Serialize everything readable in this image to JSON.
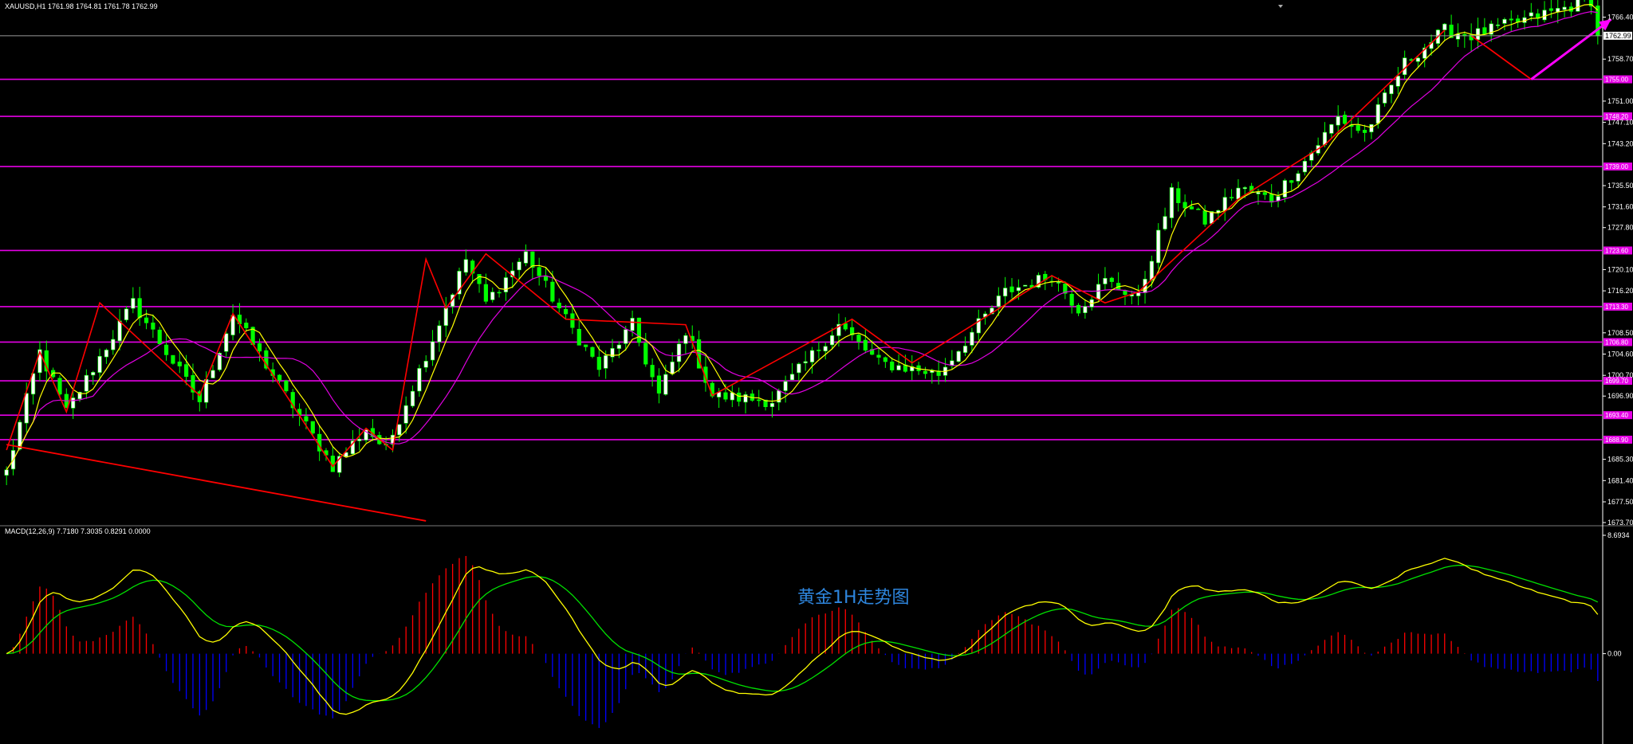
{
  "chart_data": [
    {
      "type": "candlestick",
      "symbol_info": "XAUUSD,H1  1761.98 1764.81 1761.78 1762.99",
      "ylim": [
        1673.7,
        1767.5
      ],
      "yticks": [
        {
          "label": "1766.40",
          "value": 1766.4
        },
        {
          "label": "1758.70",
          "value": 1758.7
        },
        {
          "label": "1751.00",
          "value": 1751.0
        },
        {
          "label": "1747.10",
          "value": 1747.1
        },
        {
          "label": "1743.20",
          "value": 1743.2
        },
        {
          "label": "1735.50",
          "value": 1735.5
        },
        {
          "label": "1731.60",
          "value": 1731.6
        },
        {
          "label": "1727.80",
          "value": 1727.8
        },
        {
          "label": "1720.10",
          "value": 1720.1
        },
        {
          "label": "1716.20",
          "value": 1716.2
        },
        {
          "label": "1708.50",
          "value": 1708.5
        },
        {
          "label": "1704.60",
          "value": 1704.6
        },
        {
          "label": "1700.70",
          "value": 1700.7
        },
        {
          "label": "1696.90",
          "value": 1696.9
        },
        {
          "label": "1685.30",
          "value": 1685.3
        },
        {
          "label": "1681.40",
          "value": 1681.4
        },
        {
          "label": "1677.50",
          "value": 1677.5
        },
        {
          "label": "1673.70",
          "value": 1673.7
        }
      ],
      "current_price": {
        "label": "1762.99",
        "value": 1762.99
      },
      "levels": [
        1755.0,
        1748.2,
        1739.0,
        1723.6,
        1713.3,
        1706.8,
        1699.7,
        1693.4,
        1688.9
      ],
      "level_color": "#e600e6",
      "ma_fast_color": "#ffff00",
      "ma_slow_color": "#e100e1",
      "bull_color": "#ffffff",
      "bear_color": "#00ff00",
      "zigzag_color": "#ff0000",
      "arrow_color": "#ff00ff",
      "keypoints": [
        [
          0,
          1683
        ],
        [
          5,
          1705
        ],
        [
          9,
          1694
        ],
        [
          19,
          1714
        ],
        [
          29,
          1696
        ],
        [
          34,
          1712
        ],
        [
          49,
          1684
        ],
        [
          54,
          1691
        ],
        [
          57,
          1687
        ],
        [
          69,
          1722
        ],
        [
          72,
          1714
        ],
        [
          78,
          1723
        ],
        [
          84,
          1711
        ],
        [
          89,
          1702
        ],
        [
          94,
          1710
        ],
        [
          98,
          1697
        ],
        [
          102,
          1709
        ],
        [
          106,
          1697
        ],
        [
          115,
          1696
        ],
        [
          125,
          1710
        ],
        [
          131,
          1703
        ],
        [
          140,
          1701
        ],
        [
          150,
          1716
        ],
        [
          157,
          1719
        ],
        [
          161,
          1713
        ],
        [
          165,
          1718
        ],
        [
          170,
          1715
        ],
        [
          175,
          1734
        ],
        [
          180,
          1729
        ],
        [
          185,
          1735
        ],
        [
          190,
          1733
        ],
        [
          195,
          1740
        ],
        [
          200,
          1748
        ],
        [
          204,
          1745
        ],
        [
          210,
          1758
        ],
        [
          216,
          1764
        ],
        [
          220,
          1763
        ]
      ],
      "zigzag": [
        [
          0,
          1687
        ],
        [
          5,
          1705
        ],
        [
          9,
          1694
        ],
        [
          14,
          1714
        ],
        [
          29,
          1697
        ],
        [
          34,
          1712
        ],
        [
          49,
          1684
        ],
        [
          54,
          1691
        ],
        [
          58,
          1687
        ],
        [
          63,
          1722
        ],
        [
          66,
          1713
        ],
        [
          72,
          1723
        ],
        [
          84,
          1711
        ],
        [
          102,
          1710
        ],
        [
          106,
          1697
        ],
        [
          112,
          1701
        ],
        [
          127,
          1711
        ],
        [
          136,
          1703
        ],
        [
          157,
          1719
        ],
        [
          165,
          1714
        ],
        [
          170,
          1716
        ],
        [
          185,
          1733
        ],
        [
          198,
          1743
        ],
        [
          216,
          1764
        ]
      ],
      "trendline": [
        [
          0,
          1688
        ],
        [
          63,
          1674
        ]
      ],
      "projection": [
        [
          220,
          1763
        ],
        [
          229,
          1755
        ]
      ],
      "arrow": [
        [
          229,
          1755
        ],
        [
          241,
          1766
        ]
      ]
    },
    {
      "type": "macd",
      "label": "MACD(12,26,9)  7.7180  7.3035  0.8291  0.0000",
      "ylim": [
        -6.4,
        8.6934
      ],
      "yticks": [
        {
          "label": "8.6934",
          "value": 8.6934
        },
        {
          "label": "0.00",
          "value": 0.0
        }
      ],
      "pos_color": "#ff0000",
      "neg_color": "#0000ff",
      "line_color": "#ffff00",
      "signal_color": "#00e000",
      "annotation": "黄金1H走势图",
      "annotation_color": "#2e86de"
    }
  ]
}
